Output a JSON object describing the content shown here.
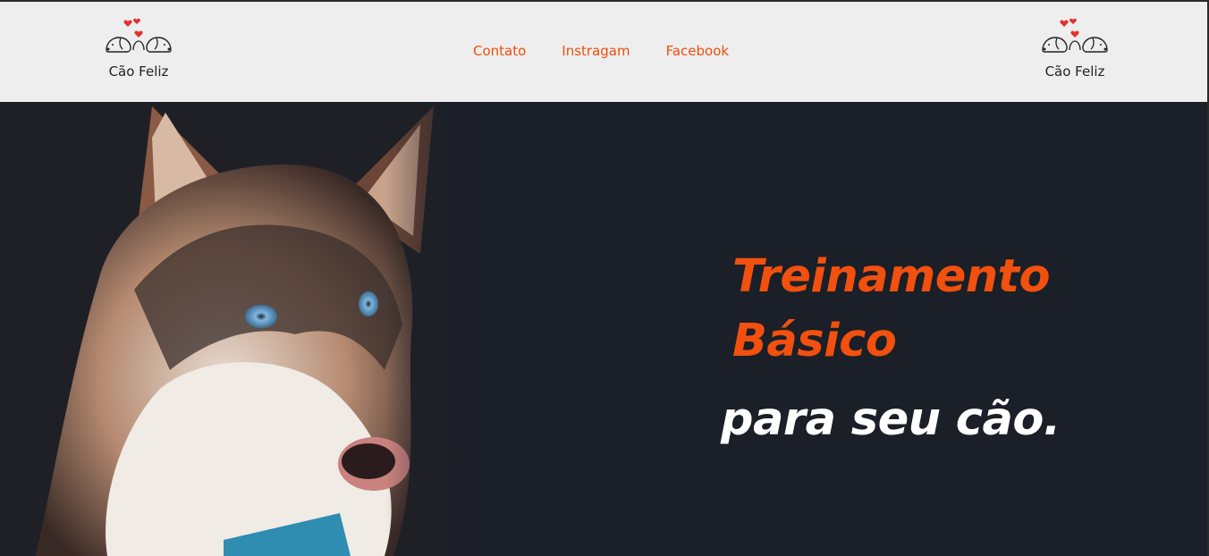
{
  "brand": {
    "name": "Cão Feliz",
    "logo_icon": "two-dogs-hearts-icon"
  },
  "nav": {
    "items": [
      {
        "label": "Contato"
      },
      {
        "label": "Instragam"
      },
      {
        "label": "Facebook"
      }
    ]
  },
  "hero": {
    "image_icon": "husky-dog-photo",
    "line1": "Treinamento",
    "line2": "Básico",
    "line3": "para seu cão."
  },
  "colors": {
    "accent": "#f2500f",
    "header_bg": "#eeeeee",
    "hero_bg": "#1b1f27"
  }
}
